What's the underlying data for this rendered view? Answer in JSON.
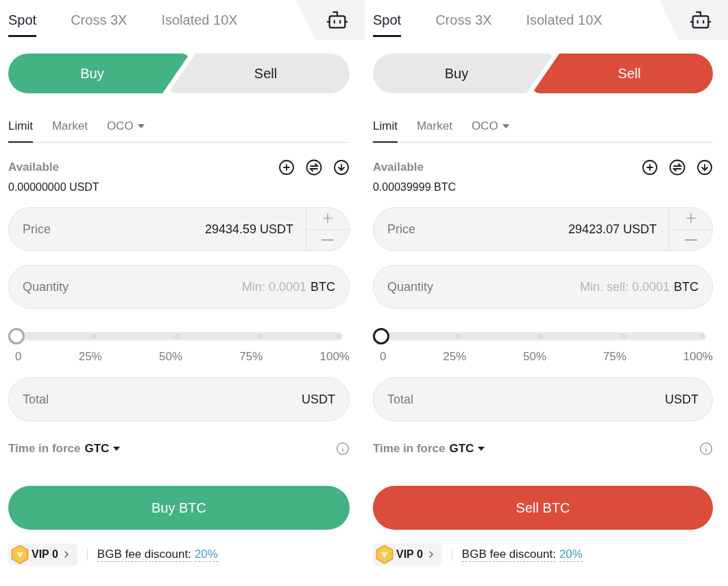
{
  "panels": [
    {
      "tabs": [
        {
          "label": "Spot",
          "selected": true
        },
        {
          "label": "Cross 3X",
          "selected": false
        },
        {
          "label": "Isolated 10X",
          "selected": false
        }
      ],
      "sides": [
        {
          "label": "Buy",
          "kind": "buy",
          "selected": true
        },
        {
          "label": "Sell",
          "kind": "sell",
          "selected": false
        }
      ],
      "order_types": [
        {
          "label": "Limit",
          "kind": "plain",
          "selected": true
        },
        {
          "label": "Market",
          "kind": "plain",
          "selected": false
        },
        {
          "label": "OCO",
          "kind": "dropdown",
          "selected": false
        }
      ],
      "available": {
        "label": "Available",
        "value": "0.00000000 USDT"
      },
      "price": {
        "label": "Price",
        "value": "29434.59",
        "unit": "USDT"
      },
      "quantity": {
        "label": "Quantity",
        "placeholder": "Min: 0.0001",
        "unit": "BTC"
      },
      "slider": {
        "level": 0,
        "marks": [
          "0",
          "25%",
          "50%",
          "75%",
          "100%"
        ]
      },
      "total": {
        "label": "Total",
        "unit": "USDT"
      },
      "time_in_force": {
        "label": "Time in force",
        "value": "GTC"
      },
      "submit": {
        "label": "Buy BTC",
        "kind": "buy"
      },
      "vip": {
        "label": "VIP 0"
      },
      "fee": {
        "label": "BGB fee discount:",
        "value": "20%"
      }
    },
    {
      "tabs": [
        {
          "label": "Spot",
          "selected": true
        },
        {
          "label": "Cross 3X",
          "selected": false
        },
        {
          "label": "Isolated 10X",
          "selected": false
        }
      ],
      "sides": [
        {
          "label": "Buy",
          "kind": "buy",
          "selected": false
        },
        {
          "label": "Sell",
          "kind": "sell",
          "selected": true
        }
      ],
      "order_types": [
        {
          "label": "Limit",
          "kind": "plain",
          "selected": true
        },
        {
          "label": "Market",
          "kind": "plain",
          "selected": false
        },
        {
          "label": "OCO",
          "kind": "dropdown",
          "selected": false
        }
      ],
      "available": {
        "label": "Available",
        "value": "0.00039999 BTC"
      },
      "price": {
        "label": "Price",
        "value": "29423.07",
        "unit": "USDT"
      },
      "quantity": {
        "label": "Quantity",
        "placeholder": "Min. sell: 0.0001",
        "unit": "BTC"
      },
      "slider": {
        "level": 0,
        "marks": [
          "0",
          "25%",
          "50%",
          "75%",
          "100%"
        ]
      },
      "total": {
        "label": "Total",
        "unit": "USDT"
      },
      "time_in_force": {
        "label": "Time in force",
        "value": "GTC"
      },
      "submit": {
        "label": "Sell BTC",
        "kind": "sell"
      },
      "vip": {
        "label": "VIP 0"
      },
      "fee": {
        "label": "BGB fee discount:",
        "value": "20%"
      }
    }
  ]
}
